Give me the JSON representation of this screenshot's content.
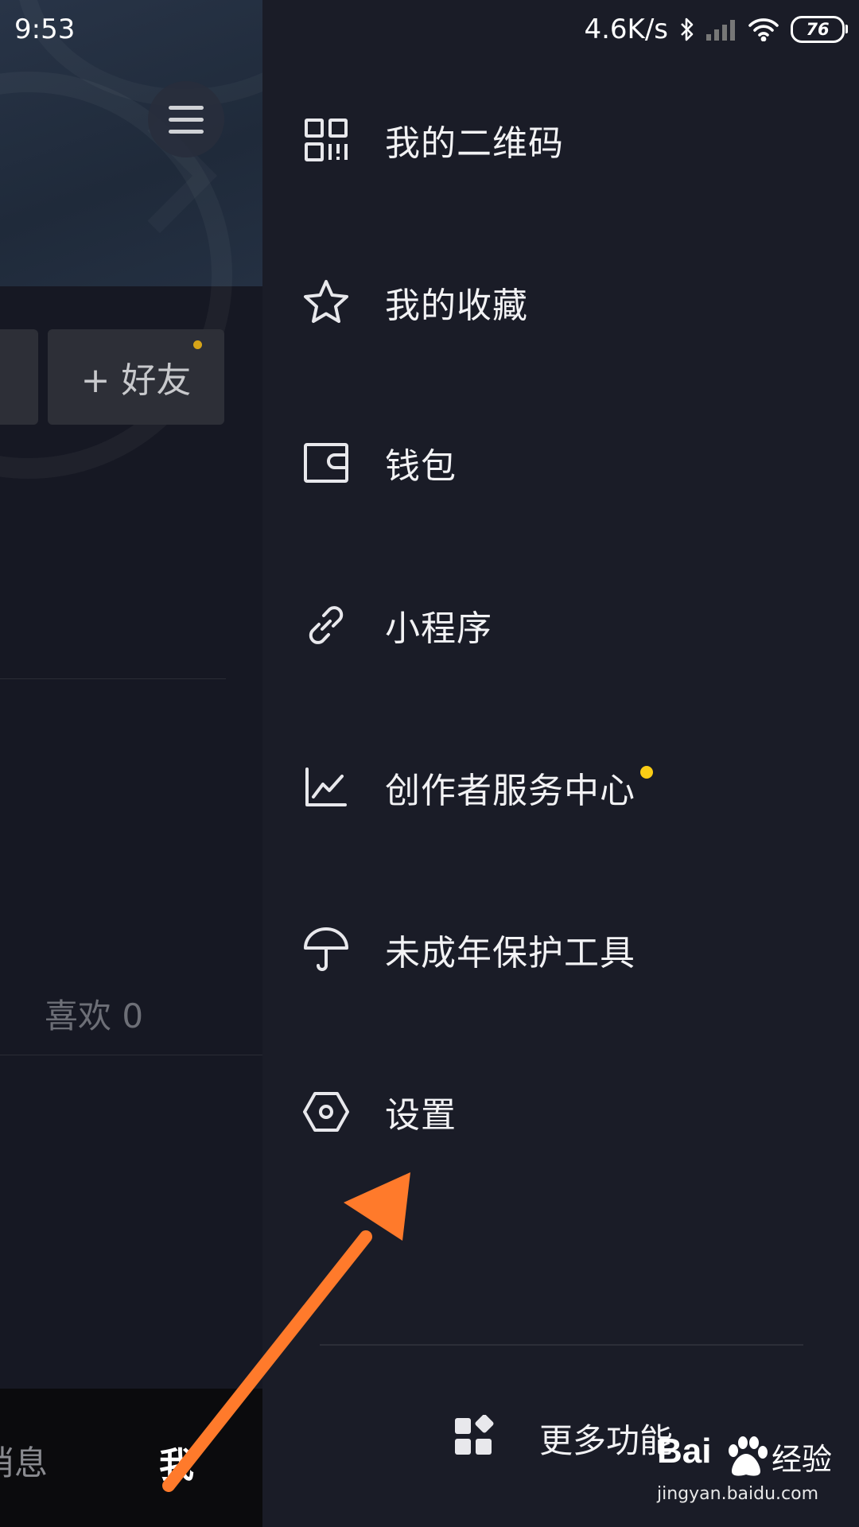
{
  "status_bar": {
    "time": "9:53",
    "network_speed": "4.6K/s",
    "battery": "76"
  },
  "profile_behind": {
    "add_friend_label": "+ 好友",
    "likes_label": "喜欢 0",
    "bottom_nav": {
      "messages": "消息",
      "me": "我"
    }
  },
  "drawer_menu": {
    "items": [
      {
        "label": "我的二维码",
        "icon": "qr-code-icon"
      },
      {
        "label": "我的收藏",
        "icon": "star-icon"
      },
      {
        "label": "钱包",
        "icon": "wallet-icon"
      },
      {
        "label": "小程序",
        "icon": "link-icon"
      },
      {
        "label": "创作者服务中心",
        "icon": "chart-icon",
        "badge": true
      },
      {
        "label": "未成年保护工具",
        "icon": "umbrella-icon"
      },
      {
        "label": "设置",
        "icon": "settings-hexagon-icon"
      }
    ],
    "more_functions": "更多功能"
  },
  "annotation": {
    "arrow_color": "#ff7a2b",
    "points_to": "设置"
  },
  "watermark": {
    "brand": "Bai",
    "brand_cn": "经验",
    "url": "jingyan.baidu.com"
  },
  "colors": {
    "drawer_bg": "#1a1c27",
    "badge_yellow": "#facc15",
    "accent_dot": "#d6a418"
  }
}
